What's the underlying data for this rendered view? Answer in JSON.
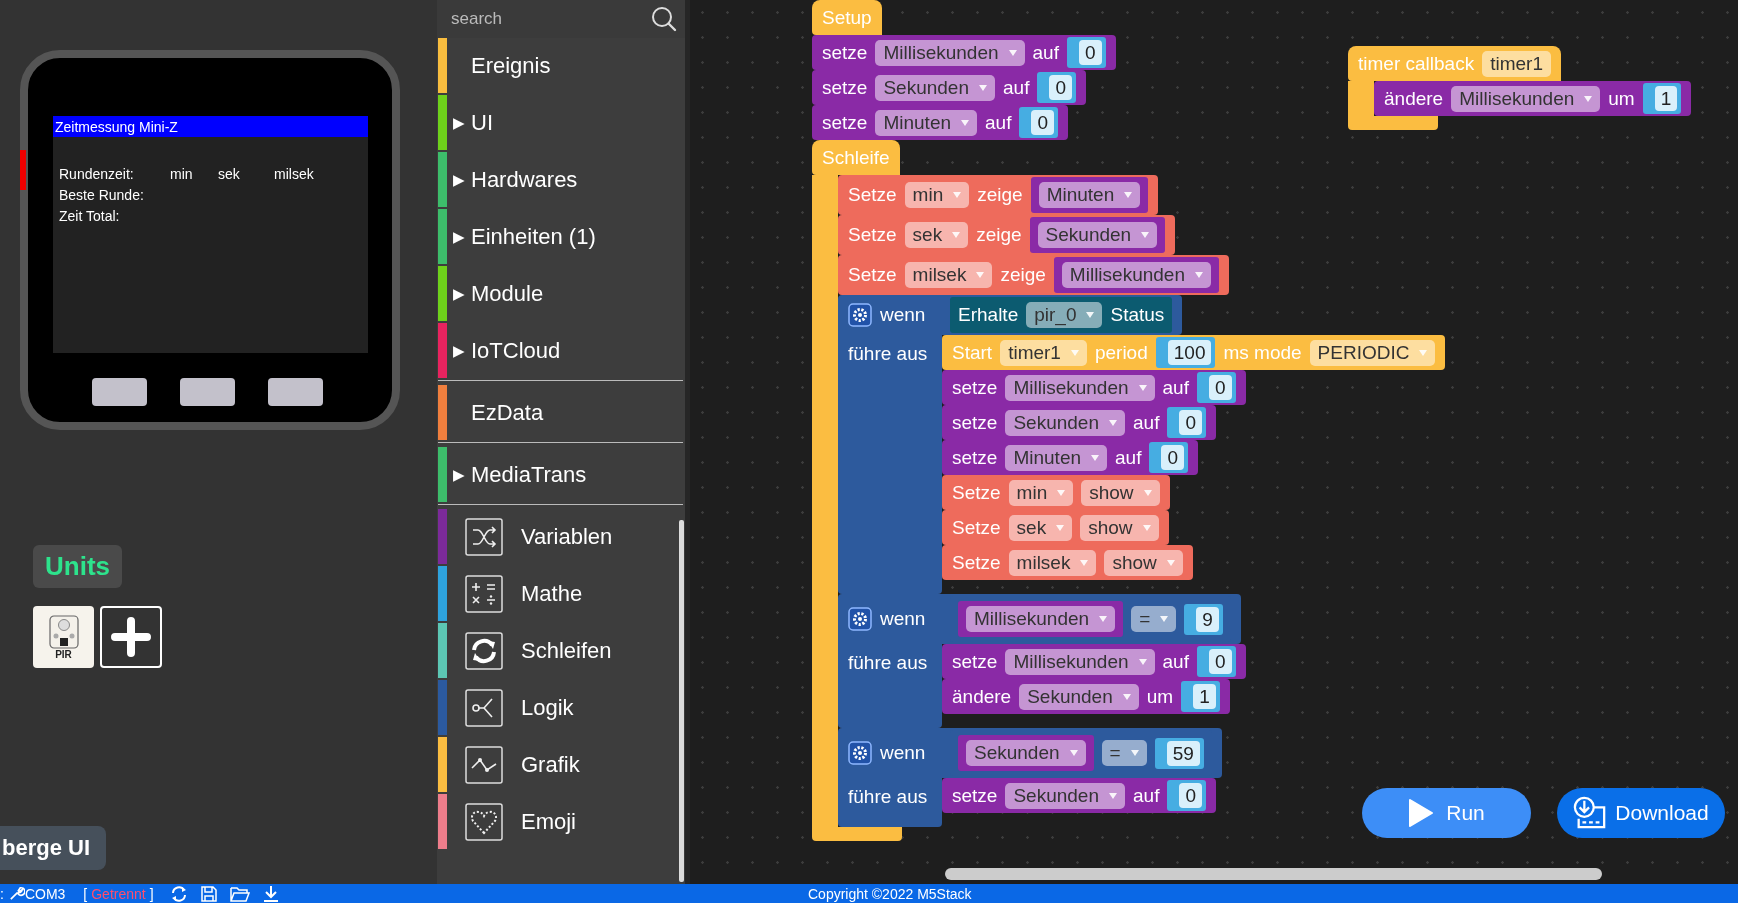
{
  "device": {
    "screen": {
      "title": "Zeitmessung Mini-Z",
      "rows": [
        {
          "items": [
            "Rundenzeit:",
            "min",
            "sek",
            "milsek"
          ]
        },
        {
          "items": [
            "Beste Runde:"
          ]
        },
        {
          "items": [
            "Zeit Total:"
          ]
        }
      ]
    }
  },
  "units": {
    "title": "Units",
    "items": [
      {
        "label": "PIR"
      }
    ]
  },
  "merge_button": "berge UI",
  "sidebar": {
    "search": {
      "placeholder": "search"
    },
    "groups": [
      {
        "items": [
          {
            "label": "Ereignis",
            "color": "#f9bd3f"
          },
          {
            "arrow": "▶",
            "label": "UI",
            "color": "#6ed11b"
          },
          {
            "arrow": "▶",
            "label": "Hardwares",
            "color": "#3dbd6b"
          },
          {
            "arrow": "▶",
            "label": "Einheiten (1)",
            "color": "#3dbd6b"
          },
          {
            "arrow": "▶",
            "label": "Module",
            "color": "#6ed11b"
          },
          {
            "arrow": "▶",
            "label": "IoTCloud",
            "color": "#e8235f"
          }
        ]
      },
      {
        "items": [
          {
            "label": "EzData",
            "color": "#f07f3e"
          }
        ]
      },
      {
        "items": [
          {
            "arrow": "▶",
            "label": "MediaTrans",
            "color": "#3dbd6b"
          }
        ]
      }
    ],
    "tools": [
      {
        "label": "Variablen",
        "color": "#7c2a9a"
      },
      {
        "label": "Mathe",
        "color": "#2ea3de"
      },
      {
        "label": "Schleifen",
        "color": "#5cc7b4"
      },
      {
        "label": "Logik",
        "color": "#2b5aa0"
      },
      {
        "label": "Grafik",
        "color": "#fbbd41"
      },
      {
        "label": "Emoji",
        "color": "#ee7d8b"
      }
    ]
  },
  "workspace": {
    "stacks": [
      {
        "kind": "hat",
        "color": "#fbbd41",
        "parts": [
          {
            "kind": "word",
            "text": "Setup"
          }
        ],
        "children": [
          {
            "kind": "statement",
            "color": "#8a2aa6",
            "parts": [
              {
                "kind": "word",
                "text": "setze"
              },
              {
                "kind": "dropdown",
                "text": "Millisekunden"
              },
              {
                "kind": "word",
                "text": "auf"
              },
              {
                "kind": "number",
                "text": "0"
              }
            ]
          },
          {
            "kind": "statement",
            "color": "#8a2aa6",
            "parts": [
              {
                "kind": "word",
                "text": "setze"
              },
              {
                "kind": "dropdown",
                "text": "Sekunden"
              },
              {
                "kind": "word",
                "text": "auf"
              },
              {
                "kind": "number",
                "text": "0"
              }
            ]
          },
          {
            "kind": "statement",
            "color": "#8a2aa6",
            "parts": [
              {
                "kind": "word",
                "text": "setze"
              },
              {
                "kind": "dropdown",
                "text": "Minuten"
              },
              {
                "kind": "word",
                "text": "auf"
              },
              {
                "kind": "number",
                "text": "0"
              }
            ]
          },
          {
            "kind": "loop",
            "color": "#fbbd41",
            "parts": [
              {
                "kind": "word",
                "text": "Schleife"
              }
            ],
            "children": [
              {
                "kind": "statement",
                "color": "#ee6b5c",
                "parts": [
                  {
                    "kind": "word",
                    "text": "Setze"
                  },
                  {
                    "kind": "dropdown",
                    "text": "min"
                  },
                  {
                    "kind": "word",
                    "text": "zeige"
                  },
                  {
                    "kind": "reporter",
                    "color": "#8a2aa6",
                    "parts": [
                      {
                        "kind": "dropdown",
                        "text": "Minuten"
                      }
                    ]
                  }
                ]
              },
              {
                "kind": "statement",
                "color": "#ee6b5c",
                "parts": [
                  {
                    "kind": "word",
                    "text": "Setze"
                  },
                  {
                    "kind": "dropdown",
                    "text": "sek"
                  },
                  {
                    "kind": "word",
                    "text": "zeige"
                  },
                  {
                    "kind": "reporter",
                    "color": "#8a2aa6",
                    "parts": [
                      {
                        "kind": "dropdown",
                        "text": "Sekunden"
                      }
                    ]
                  }
                ]
              },
              {
                "kind": "statement",
                "color": "#ee6b5c",
                "parts": [
                  {
                    "kind": "word",
                    "text": "Setze"
                  },
                  {
                    "kind": "dropdown",
                    "text": "milsek"
                  },
                  {
                    "kind": "word",
                    "text": "zeige"
                  },
                  {
                    "kind": "reporter",
                    "color": "#8a2aa6",
                    "parts": [
                      {
                        "kind": "dropdown",
                        "text": "Millisekunden"
                      }
                    ]
                  }
                ]
              },
              {
                "kind": "if",
                "color": "#2d5a9d",
                "do_label": "führe aus",
                "parts": [
                  {
                    "kind": "word",
                    "text": "wenn"
                  },
                  {
                    "kind": "reporter",
                    "color": "#0c5b70",
                    "parts": [
                      {
                        "kind": "word",
                        "text": "Erhalte"
                      },
                      {
                        "kind": "dropdown",
                        "text": "pir_0"
                      },
                      {
                        "kind": "word",
                        "text": "Status"
                      }
                    ]
                  }
                ],
                "children": [
                  {
                    "kind": "statement",
                    "color": "#fbbd41",
                    "parts": [
                      {
                        "kind": "word",
                        "text": "Start"
                      },
                      {
                        "kind": "dropdown",
                        "text": "timer1"
                      },
                      {
                        "kind": "word",
                        "text": "period"
                      },
                      {
                        "kind": "number",
                        "text": "100"
                      },
                      {
                        "kind": "word",
                        "text": "ms mode"
                      },
                      {
                        "kind": "dropdown",
                        "text": "PERIODIC"
                      }
                    ]
                  },
                  {
                    "kind": "statement",
                    "color": "#8a2aa6",
                    "parts": [
                      {
                        "kind": "word",
                        "text": "setze"
                      },
                      {
                        "kind": "dropdown",
                        "text": "Millisekunden"
                      },
                      {
                        "kind": "word",
                        "text": "auf"
                      },
                      {
                        "kind": "number",
                        "text": "0"
                      }
                    ]
                  },
                  {
                    "kind": "statement",
                    "color": "#8a2aa6",
                    "parts": [
                      {
                        "kind": "word",
                        "text": "setze"
                      },
                      {
                        "kind": "dropdown",
                        "text": "Sekunden"
                      },
                      {
                        "kind": "word",
                        "text": "auf"
                      },
                      {
                        "kind": "number",
                        "text": "0"
                      }
                    ]
                  },
                  {
                    "kind": "statement",
                    "color": "#8a2aa6",
                    "parts": [
                      {
                        "kind": "word",
                        "text": "setze"
                      },
                      {
                        "kind": "dropdown",
                        "text": "Minuten"
                      },
                      {
                        "kind": "word",
                        "text": "auf"
                      },
                      {
                        "kind": "number",
                        "text": "0"
                      }
                    ]
                  },
                  {
                    "kind": "statement",
                    "color": "#ee6b5c",
                    "parts": [
                      {
                        "kind": "word",
                        "text": "Setze"
                      },
                      {
                        "kind": "dropdown",
                        "text": "min"
                      },
                      {
                        "kind": "dropdown",
                        "text": "show"
                      }
                    ]
                  },
                  {
                    "kind": "statement",
                    "color": "#ee6b5c",
                    "parts": [
                      {
                        "kind": "word",
                        "text": "Setze"
                      },
                      {
                        "kind": "dropdown",
                        "text": "sek"
                      },
                      {
                        "kind": "dropdown",
                        "text": "show"
                      }
                    ]
                  },
                  {
                    "kind": "statement",
                    "color": "#ee6b5c",
                    "parts": [
                      {
                        "kind": "word",
                        "text": "Setze"
                      },
                      {
                        "kind": "dropdown",
                        "text": "milsek"
                      },
                      {
                        "kind": "dropdown",
                        "text": "show"
                      }
                    ]
                  }
                ]
              },
              {
                "kind": "if",
                "color": "#2d5a9d",
                "do_label": "führe aus",
                "parts": [
                  {
                    "kind": "word",
                    "text": "wenn"
                  },
                  {
                    "kind": "reporter",
                    "color": "#2d5a9d",
                    "parts": [
                      {
                        "kind": "reporter",
                        "color": "#8a2aa6",
                        "parts": [
                          {
                            "kind": "dropdown",
                            "text": "Millisekunden"
                          }
                        ]
                      },
                      {
                        "kind": "dropdown",
                        "text": "="
                      },
                      {
                        "kind": "number",
                        "text": "9"
                      }
                    ]
                  }
                ],
                "children": [
                  {
                    "kind": "statement",
                    "color": "#8a2aa6",
                    "parts": [
                      {
                        "kind": "word",
                        "text": "setze"
                      },
                      {
                        "kind": "dropdown",
                        "text": "Millisekunden"
                      },
                      {
                        "kind": "word",
                        "text": "auf"
                      },
                      {
                        "kind": "number",
                        "text": "0"
                      }
                    ]
                  },
                  {
                    "kind": "statement",
                    "color": "#8a2aa6",
                    "parts": [
                      {
                        "kind": "word",
                        "text": "ändere"
                      },
                      {
                        "kind": "dropdown",
                        "text": "Sekunden"
                      },
                      {
                        "kind": "word",
                        "text": "um"
                      },
                      {
                        "kind": "number",
                        "text": "1"
                      }
                    ]
                  }
                ]
              },
              {
                "kind": "if",
                "color": "#2d5a9d",
                "do_label": "führe aus",
                "parts": [
                  {
                    "kind": "word",
                    "text": "wenn"
                  },
                  {
                    "kind": "reporter",
                    "color": "#2d5a9d",
                    "parts": [
                      {
                        "kind": "reporter",
                        "color": "#8a2aa6",
                        "parts": [
                          {
                            "kind": "dropdown",
                            "text": "Sekunden"
                          }
                        ]
                      },
                      {
                        "kind": "dropdown",
                        "text": "="
                      },
                      {
                        "kind": "number",
                        "text": "59"
                      }
                    ]
                  }
                ],
                "children": [
                  {
                    "kind": "statement",
                    "color": "#8a2aa6",
                    "parts": [
                      {
                        "kind": "word",
                        "text": "setze"
                      },
                      {
                        "kind": "dropdown",
                        "text": "Sekunden"
                      },
                      {
                        "kind": "word",
                        "text": "auf"
                      },
                      {
                        "kind": "number",
                        "text": "0"
                      }
                    ]
                  }
                ]
              }
            ]
          }
        ]
      },
      {
        "kind": "loop",
        "color": "#fbbd41",
        "parts": [
          {
            "kind": "word",
            "text": "timer callback"
          },
          {
            "kind": "field",
            "text": "timer1"
          }
        ],
        "children": [
          {
            "kind": "statement",
            "color": "#8a2aa6",
            "parts": [
              {
                "kind": "word",
                "text": "ändere"
              },
              {
                "kind": "dropdown",
                "text": "Millisekunden"
              },
              {
                "kind": "word",
                "text": "um"
              },
              {
                "kind": "number",
                "text": "1"
              }
            ]
          }
        ]
      }
    ]
  },
  "actions": [
    {
      "kind": "run",
      "label": "Run"
    },
    {
      "kind": "download",
      "label": "Download"
    }
  ],
  "status_bar": {
    "port_prefix": ":",
    "port": "COM3",
    "bracket_open": "[",
    "connection": "Getrennt",
    "bracket_close": "]",
    "copyright": "Copyright ©2022 M5Stack"
  }
}
